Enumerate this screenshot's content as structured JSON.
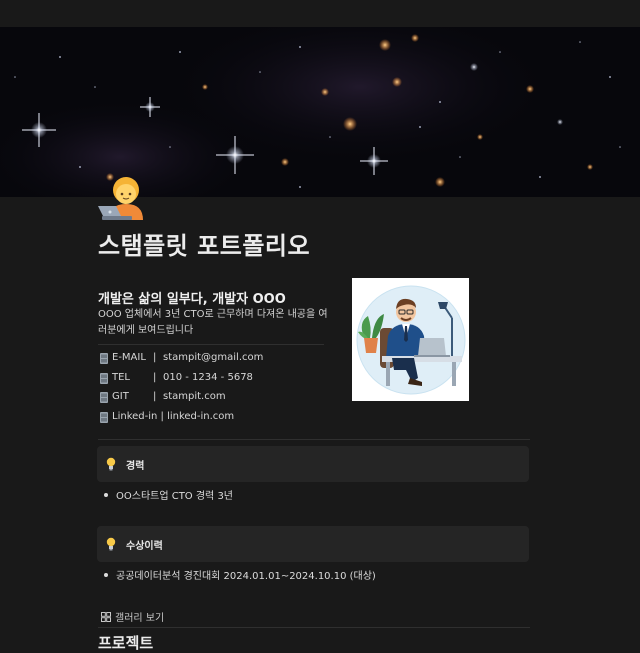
{
  "page": {
    "title": "스탬플릿 포트폴리오",
    "icon": "technologist-emoji-icon"
  },
  "intro": {
    "tagline": "개발은 삶의 일부다, 개발자 OOO",
    "description": "OOO 업체에서 3년 CTO로 근무하며 다져온 내공을 여러분에게 보여드립니다"
  },
  "contacts": [
    {
      "key": "E-MAIL",
      "value": "stampit@gmail.com"
    },
    {
      "key": "TEL",
      "value": "010 - 1234 - 5678"
    },
    {
      "key": "GIT",
      "value": "stampit.com"
    }
  ],
  "contact_linkedin": "Linked-in | linked-in.com",
  "contact_separator": "|",
  "career": {
    "title": "경력",
    "items": [
      "OO스타트업 CTO 경력 3년"
    ]
  },
  "awards": {
    "title": "수상이력",
    "items": [
      "공공데이터분석 경진대회 2024.01.01~2024.10.10 (대상)"
    ]
  },
  "gallery": {
    "label": "갤러리 보기"
  },
  "next_section": {
    "title": "프로젝트"
  },
  "colors": {
    "background": "#191919",
    "callout": "#252525",
    "divider": "#2f2f2f"
  }
}
